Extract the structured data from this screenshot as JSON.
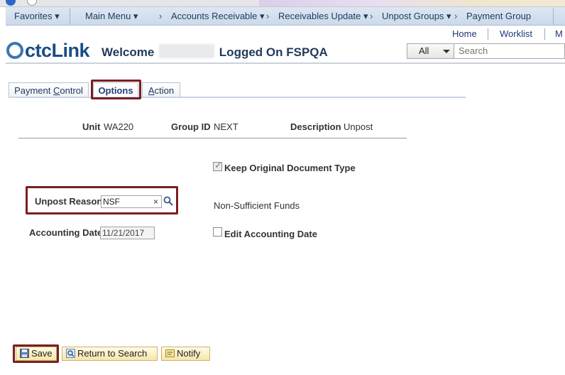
{
  "navbar": {
    "favorites": "Favorites",
    "main_menu": "Main Menu",
    "crumbs": [
      "Accounts Receivable",
      "Receivables Update",
      "Unpost Groups",
      "Payment Group"
    ]
  },
  "header_links": {
    "home": "Home",
    "worklist": "Worklist",
    "more": "M"
  },
  "logo": {
    "text": "ctcLink"
  },
  "welcome": {
    "prefix": "Welcome",
    "suffix": "Logged On FSPQA"
  },
  "search": {
    "scope": "All",
    "placeholder": "Search"
  },
  "tabs": [
    "Payment Control",
    "Options",
    "Action"
  ],
  "tab_accesskeys": {
    "payment_control": "C",
    "action": "A"
  },
  "header_fields": {
    "unit_label": "Unit",
    "unit_value": "WA220",
    "group_label": "Group ID",
    "group_value": "NEXT",
    "desc_label": "Description",
    "desc_value": "Unpost"
  },
  "form": {
    "keep_original_label": "Keep Original Document Type",
    "keep_original_checked": true,
    "unpost_reason_label": "Unpost Reason",
    "unpost_reason_value": "NSF",
    "unpost_reason_desc": "Non-Sufficient Funds",
    "accounting_date_label": "Accounting Date",
    "accounting_date_value": "11/21/2017",
    "edit_accounting_label": "Edit Accounting Date",
    "edit_accounting_checked": false
  },
  "buttons": {
    "save": "Save",
    "return": "Return to Search",
    "notify": "Notify"
  },
  "colors": {
    "highlight_box": "#7a1e22",
    "nav_bg": "#cbd9ea",
    "button_bg": "#f6e6a8"
  }
}
